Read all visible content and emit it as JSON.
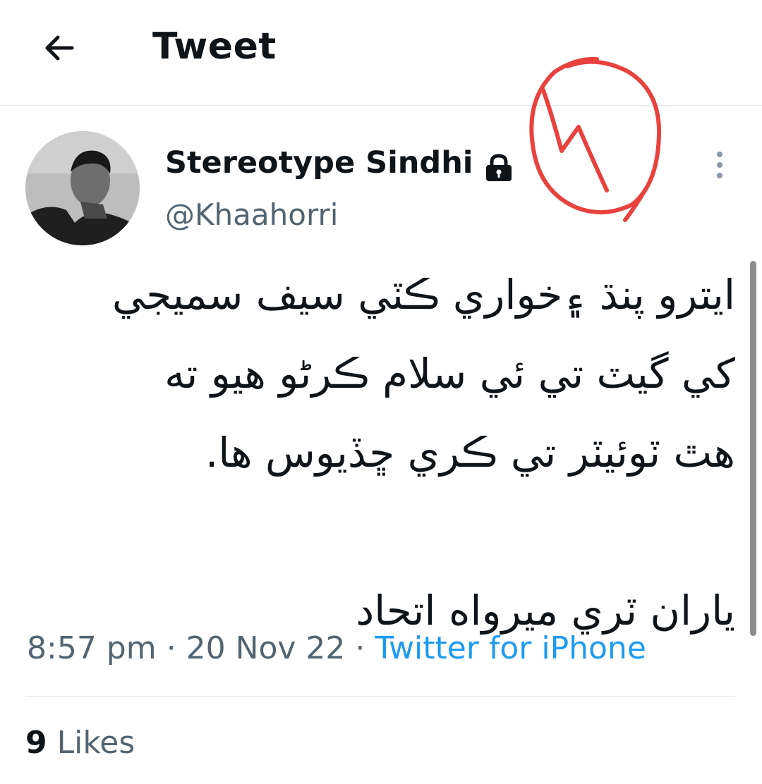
{
  "header": {
    "title": "Tweet",
    "back_icon": "arrow-left-icon"
  },
  "author": {
    "display_name": "Stereotype Sindhi",
    "handle": "@Khaahorri",
    "protected_icon": "lock-icon",
    "avatar": "profile-photo"
  },
  "tweet": {
    "lines": [
      "ايترو پنڌ ۽خواري ڪٽي سيف سميجي",
      "کي گيٽ تي ئي سلام ڪرڻو هيو ته",
      "هٿ ٽوئيٽر تي ڪري ڇڏيوس ها.",
      "",
      "ياران ٽري ميرواه اتحاد"
    ],
    "time": "8:57 pm",
    "date": "20 Nov 22",
    "separator": "·",
    "source": "Twitter for iPhone"
  },
  "stats": {
    "likes_count": "9",
    "likes_label": "Likes"
  },
  "more_icon": "more-vertical-icon",
  "colors": {
    "text": "#0f1419",
    "secondary": "#536471",
    "link": "#1d9bf0",
    "annotation": "#e8423f"
  }
}
